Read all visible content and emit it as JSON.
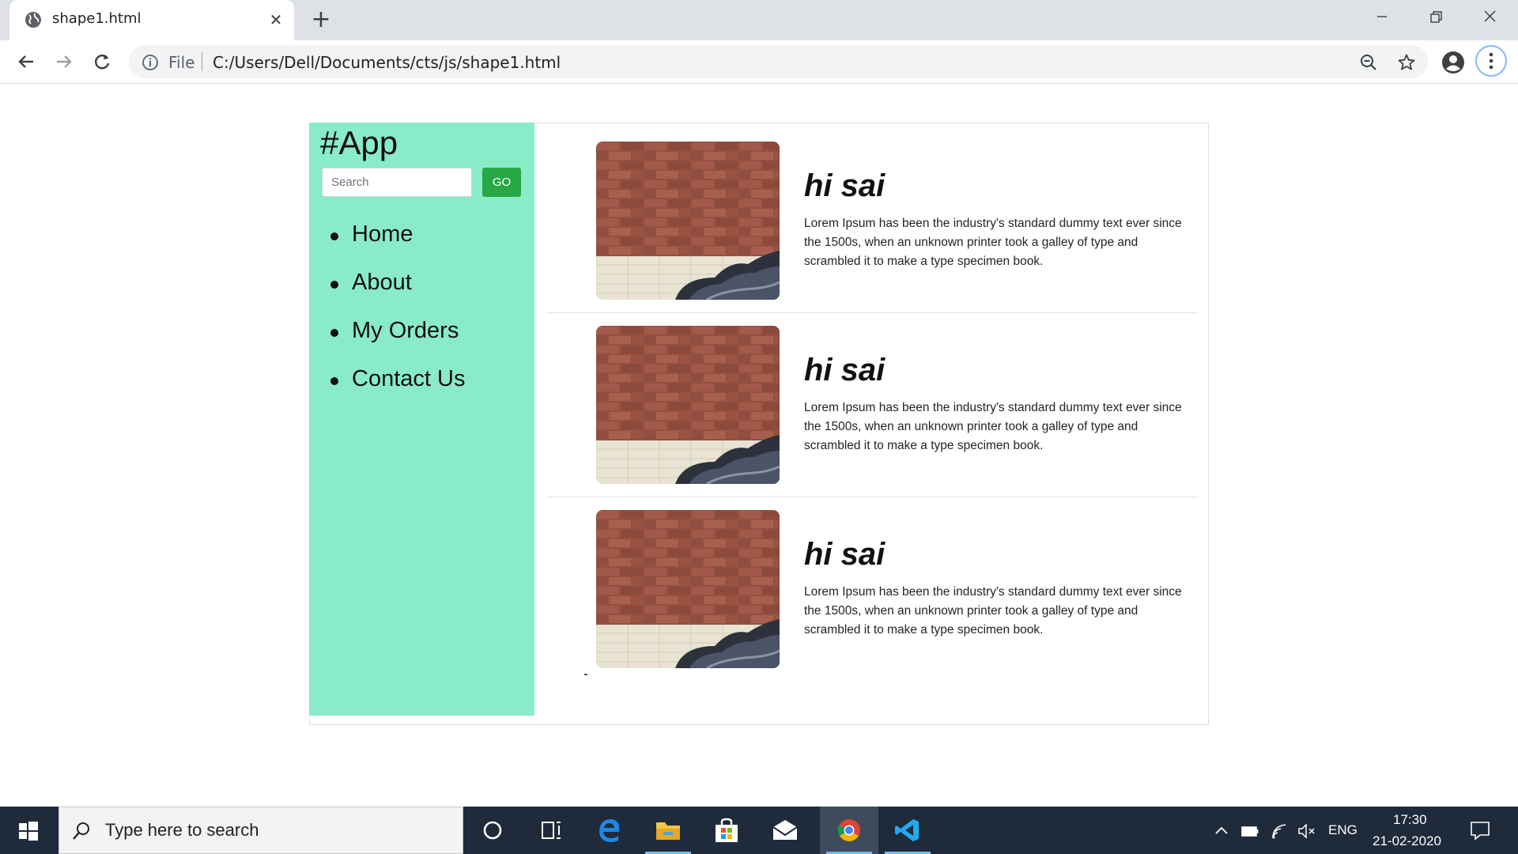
{
  "browser": {
    "tab_title": "shape1.html",
    "address_scheme": "File",
    "address_url": "C:/Users/Dell/Documents/cts/js/shape1.html"
  },
  "app": {
    "title": "#App",
    "search": {
      "placeholder": "Search",
      "button_label": "GO"
    },
    "nav": [
      {
        "label": "Home"
      },
      {
        "label": "About"
      },
      {
        "label": "My Orders"
      },
      {
        "label": "Contact Us"
      }
    ],
    "items": [
      {
        "heading": "hi sai",
        "text": "Lorem Ipsum has been the industry's standard dummy text ever since the 1500s, when an unknown printer took a galley of type and scrambled it to make a type specimen book."
      },
      {
        "heading": "hi sai",
        "text": "Lorem Ipsum has been the industry's standard dummy text ever since the 1500s, when an unknown printer took a galley of type and scrambled it to make a type specimen book."
      },
      {
        "heading": "hi sai",
        "text": "Lorem Ipsum has been the industry's standard dummy text ever since the 1500s, when an unknown printer took a galley of type and scrambled it to make a type specimen book."
      }
    ],
    "colors": {
      "sidebar": "#8aebc8",
      "go_button": "#28a745"
    }
  },
  "taskbar": {
    "search_placeholder": "Type here to search",
    "language": "ENG",
    "time": "17:30",
    "date": "21-02-2020"
  }
}
